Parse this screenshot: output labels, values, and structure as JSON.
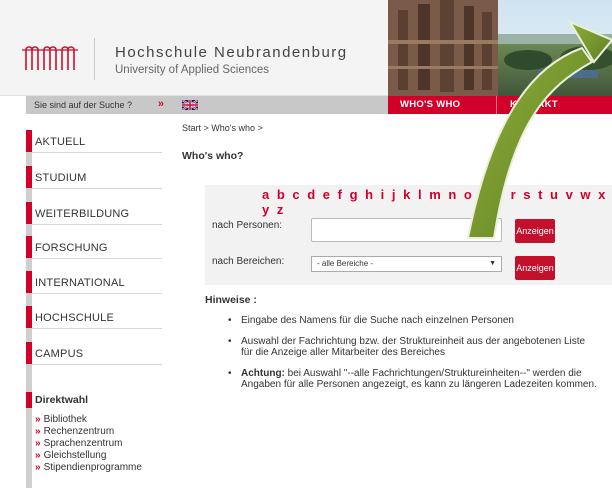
{
  "header": {
    "title": "Hochschule Neubrandenburg",
    "subtitle": "University of Applied Sciences",
    "logo_icon": "hsnb-logo-icon"
  },
  "topbar": {
    "search_hint": "Sie sind auf der Suche ?",
    "search_chevron": "»",
    "lang_flag": "uk-flag-icon",
    "nav": [
      {
        "label": "WHO'S WHO"
      },
      {
        "label": "KONTAKT"
      }
    ]
  },
  "sidebar": {
    "items": [
      {
        "label": "AKTUELL"
      },
      {
        "label": "STUDIUM"
      },
      {
        "label": "WEITERBILDUNG"
      },
      {
        "label": "FORSCHUNG"
      },
      {
        "label": "INTERNATIONAL"
      },
      {
        "label": "HOCHSCHULE"
      },
      {
        "label": "CAMPUS"
      }
    ],
    "direktwahl": {
      "title": "Direktwahl",
      "chevron": "»",
      "links": [
        {
          "label": "Bibliothek"
        },
        {
          "label": "Rechenzentrum"
        },
        {
          "label": "Sprachenzentrum"
        },
        {
          "label": "Gleichstellung"
        },
        {
          "label": "Stipendienprogramme"
        }
      ]
    }
  },
  "main": {
    "breadcrumb": "Start > Who's who >",
    "title": "Who's who?",
    "alphabet": "a b c d e f g h i j k l m n o p q r s t u v w x y z",
    "person_label": "nach Personen:",
    "person_value": "",
    "area_label": "nach Bereichen:",
    "area_select": "- alle Bereiche -",
    "button_label": "Anzeigen",
    "hinweise_title": "Hinweise :",
    "bullets": [
      {
        "text": "Eingabe des Namens für die Suche nach einzelnen Personen"
      },
      {
        "text": "Auswahl der Fachrichtung bzw. der Struktureinheit aus der angebotenen Liste für die Anzeige aller Mitarbeiter des Bereiches"
      },
      {
        "strong": "Achtung:",
        "text": " bei Auswahl \"--alle Fachrichtungen/Struktureinheiten--\" werden die Angaben für alle Personen angezeigt, es kann zu längeren Ladezeiten kommen."
      }
    ]
  },
  "colors": {
    "brand_red": "#d1002a",
    "overlay_green": "#7a9a2e"
  }
}
